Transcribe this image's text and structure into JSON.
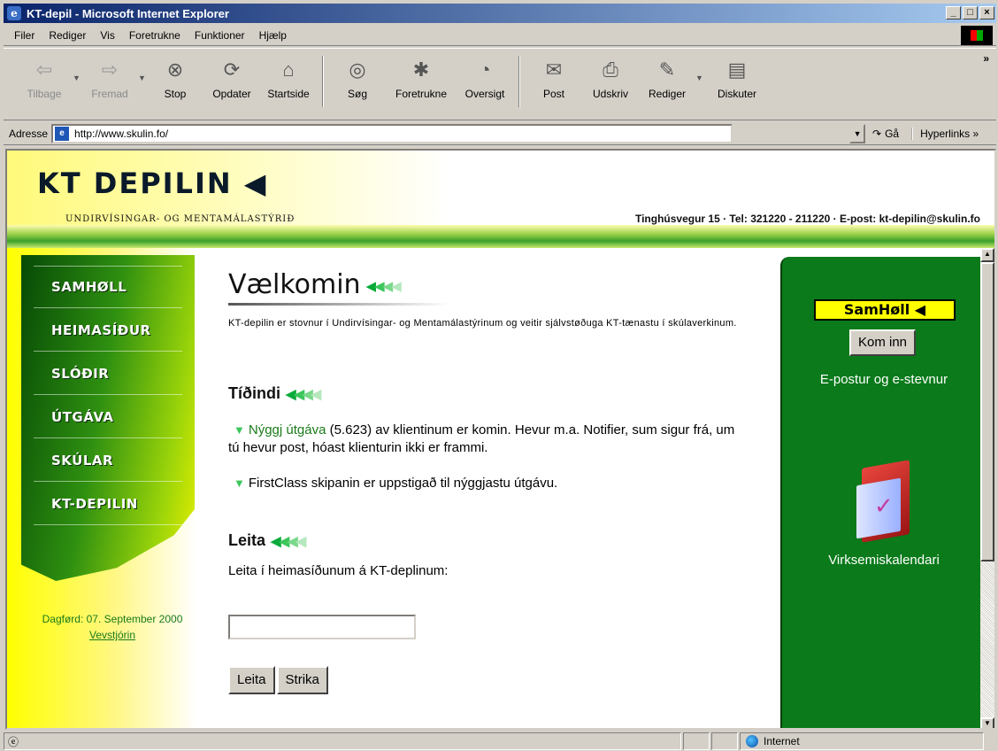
{
  "window": {
    "title": "KT-depil - Microsoft Internet Explorer",
    "controls": [
      "_",
      "□",
      "×"
    ]
  },
  "menu": {
    "items": [
      "Filer",
      "Rediger",
      "Vis",
      "Foretrukne",
      "Funktioner",
      "Hjælp"
    ]
  },
  "toolbar": {
    "back": "Tilbage",
    "forward": "Fremad",
    "stop": "Stop",
    "refresh": "Opdater",
    "home": "Startside",
    "search": "Søg",
    "favorites": "Foretrukne",
    "history": "Oversigt",
    "mail": "Post",
    "print": "Udskriv",
    "edit": "Rediger",
    "discuss": "Diskuter",
    "more": "»"
  },
  "address": {
    "label": "Adresse",
    "url": "http://www.skulin.fo/",
    "go": "Gå",
    "links": "Hyperlinks »"
  },
  "site": {
    "logo": "KT DEPILIN",
    "tagline": "UNDIRVÍSINGAR- OG MENTAMÁLASTÝRIÐ",
    "contact": "Tinghúsvegur 15  ·  Tel: 321220 - 211220  ·  E-post: kt-depilin@skulin.fo",
    "nav": [
      "SAMHØLL",
      "HEIMASÍÐUR",
      "SLÓÐIR",
      "ÚTGÁVA",
      "SKÚLAR",
      "KT-DEPILIN"
    ],
    "date": "Dagførd: 07. September 2000",
    "webmaster": "Vevstjórin"
  },
  "main": {
    "welcome": "Vælkomin",
    "intro": "KT-depilin er stovnur í Undirvísingar- og Mentamálastýrinum og veitir sjálvstøðuga KT-tænastu í skúlaverkinum.",
    "news_heading": "Tíðindi",
    "news": [
      {
        "link": "Nýggj útgáva",
        "text": " (5.623) av klientinum er komin. Hevur m.a. Notifier, sum sigur frá, um tú hevur post, hóast klienturin ikki er frammi."
      },
      {
        "link": "",
        "text": "FirstClass skipanin er uppstigað til nýggjastu útgávu."
      }
    ],
    "search_heading": "Leita",
    "search_label": "Leita í heimasíðunum á KT-deplinum:",
    "search_value": "",
    "btn_search": "Leita",
    "btn_clear": "Strika"
  },
  "right": {
    "samholl": "SamHøll ◀",
    "kom_inn": "Kom inn",
    "epost": "E-postur og e-stevnur",
    "calendar": "Virksemiskalendari"
  },
  "status": {
    "zone": "Internet"
  }
}
